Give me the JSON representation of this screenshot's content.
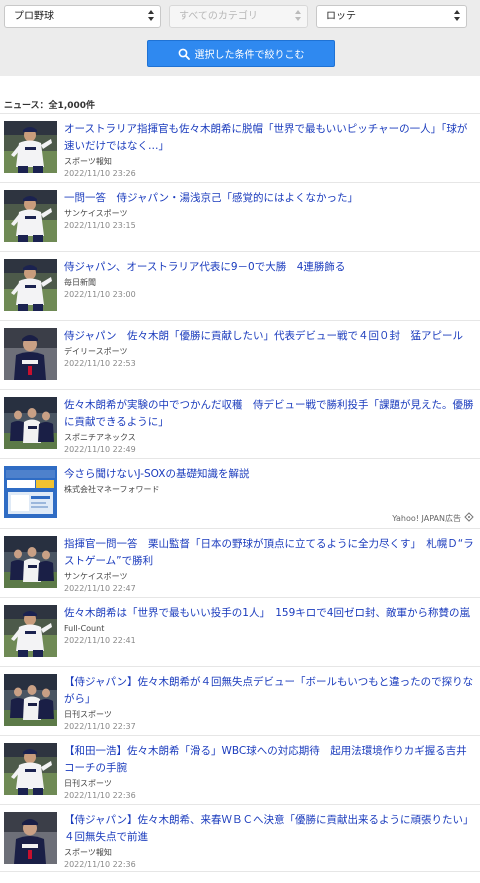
{
  "filters": {
    "category_select": "プロ野球",
    "subcategory_select": "すべてのカテゴリ",
    "team_select": "ロッテ",
    "search_button_label": "選択した条件で絞りこむ"
  },
  "news_count_label": "ニュース：全1,000件",
  "articles": [
    {
      "title": "オーストラリア指揮官も佐々木朗希に脱帽「世界で最もいいピッチャーの一人」「球が速いだけではなく…」",
      "source": "スポーツ報知",
      "date": "2022/11/10 23:26",
      "thumb_icon": "pitcher-photo",
      "ad": false
    },
    {
      "title": "一問一答　侍ジャパン・湯浅京己「感覚的にはよくなかった」",
      "source": "サンケイスポーツ",
      "date": "2022/11/10 23:15",
      "thumb_icon": "pitcher-photo",
      "ad": false
    },
    {
      "title": "侍ジャパン、オーストラリア代表に9－0で大勝　4連勝飾る",
      "source": "毎日新聞",
      "date": "2022/11/10 23:00",
      "thumb_icon": "pitcher-photo",
      "ad": false
    },
    {
      "title": "侍ジャパン　佐々木朗「優勝に貢献したい」代表デビュー戦で４回０封　猛アピール",
      "source": "デイリースポーツ",
      "date": "2022/11/10 22:53",
      "thumb_icon": "player-photo",
      "ad": false
    },
    {
      "title": "佐々木朗希が実験の中でつかんだ収穫　侍デビュー戦で勝利投手「課題が見えた。優勝に貢献できるように」",
      "source": "スポニチアネックス",
      "date": "2022/11/10 22:49",
      "thumb_icon": "team-photo",
      "ad": false
    },
    {
      "title": "今さら聞けないJ-SOXの基礎知識を解説",
      "source": "株式会社マネーフォワード",
      "date": "",
      "thumb_icon": "ad-banner",
      "ad": true,
      "ad_label": "Yahoo! JAPAN広告"
    },
    {
      "title": "指揮官一問一答　栗山監督「日本の野球が頂点に立てるように全力尽くす」　札幌Ｄ“ラストゲーム”で勝利",
      "source": "サンケイスポーツ",
      "date": "2022/11/10 22:47",
      "thumb_icon": "team-photo",
      "ad": false
    },
    {
      "title": "佐々木朗希は「世界で最もいい投手の1人」　159キロで4回ゼロ封、敵軍から称賛の嵐",
      "source": "Full-Count",
      "date": "2022/11/10 22:41",
      "thumb_icon": "pitcher-photo",
      "ad": false
    },
    {
      "title": "【侍ジャパン】佐々木朗希が４回無失点デビュー「ボールもいつもと違ったので探りながら」",
      "source": "日刊スポーツ",
      "date": "2022/11/10 22:37",
      "thumb_icon": "team-photo",
      "ad": false
    },
    {
      "title": "【和田一浩】佐々木朗希「滑る」WBC球への対応期待　起用法環境作りカギ握る吉井コーチの手腕",
      "source": "日刊スポーツ",
      "date": "2022/11/10 22:36",
      "thumb_icon": "pitcher-photo",
      "ad": false
    },
    {
      "title": "【侍ジャパン】佐々木朗希、来春ＷＢＣへ決意「優勝に貢献出来るように頑張りたい」４回無失点で前進",
      "source": "スポーツ報知",
      "date": "2022/11/10 22:36",
      "thumb_icon": "player-photo",
      "ad": false
    }
  ],
  "colors": {
    "link": "#1a3bbd",
    "button": "#2f89f0",
    "filter_bg": "#ececec"
  }
}
